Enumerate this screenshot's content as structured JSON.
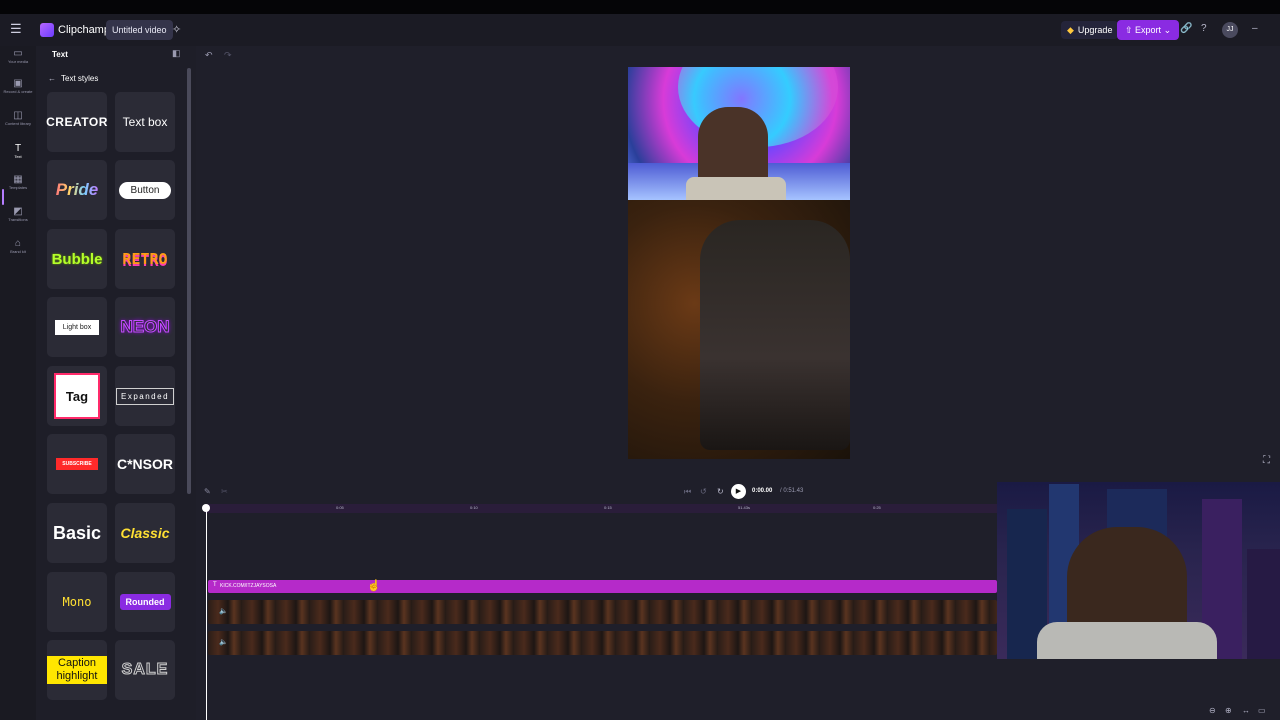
{
  "app": {
    "brand": "Clipchamp",
    "project_title": "Untitled video",
    "upgrade_label": "Upgrade",
    "export_label": "Export",
    "avatar_initials": "JJ"
  },
  "rail": {
    "items": [
      {
        "label": "Your media",
        "icon": "folder-icon"
      },
      {
        "label": "Record & create",
        "icon": "record-icon"
      },
      {
        "label": "Content library",
        "icon": "library-icon"
      },
      {
        "label": "Text",
        "icon": "text-icon"
      },
      {
        "label": "Templates",
        "icon": "templates-icon"
      },
      {
        "label": "Transitions",
        "icon": "transitions-icon"
      },
      {
        "label": "Brand kit",
        "icon": "brand-kit-icon"
      }
    ]
  },
  "panel": {
    "title": "Text",
    "back_label": "Text styles",
    "styles": [
      "CREATOR",
      "Text box",
      "Pride",
      "Button",
      "Bubble",
      "RETRO",
      "Light box",
      "NEON",
      "Tag",
      "Expanded",
      "SUBSCRIBE",
      "C*NSOR",
      "Basic",
      "Classic",
      "Mono",
      "Rounded",
      "Caption highlight",
      "SALE"
    ]
  },
  "playback": {
    "current_time": "0:00.00",
    "total_time": "/ 0:51.43"
  },
  "timeline": {
    "ticks": [
      "0:05",
      "0:10",
      "0:15",
      "0:20",
      "0:25"
    ],
    "marker": "51.43s",
    "text_clip_label": "KICK.COM/ITZJAYSOSA"
  },
  "colors": {
    "accent": "#8a2be2",
    "text_clip": "#b52ac9",
    "background": "#1f1f2a"
  }
}
